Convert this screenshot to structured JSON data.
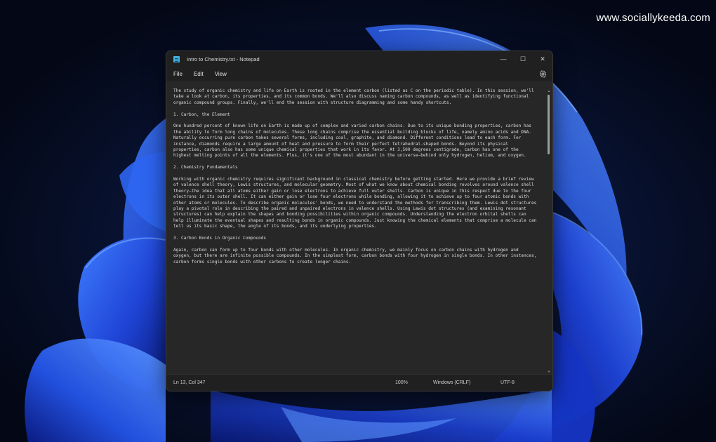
{
  "watermark": "www.sociallykeeda.com",
  "window": {
    "title": "Intro to Chemistry.txt - Notepad",
    "controls": {
      "minimize": "—",
      "maximize": "☐",
      "close": "✕"
    }
  },
  "menu": {
    "file": "File",
    "edit": "Edit",
    "view": "View"
  },
  "document": {
    "paragraphs": [
      "The study of organic chemistry and life on Earth is rooted in the element carbon (listed as C on the periodic table). In this session, we'll take a look at carbon, its properties, and its common bonds. We'll also discuss naming carbon compounds, as well as identifying functional organic compound groups. Finally, we'll end the session with structure diagramming and some handy shortcuts.",
      "1. Carbon, the Element",
      "One hundred percent of known life on Earth is made up of complex and varied carbon chains. Due to its unique bonding properties, carbon has the ability to form long chains of molecules. These long chains comprise the essential building blocks of life, namely amino acids and DNA. Naturally occurring pure carbon takes several forms, including coal, graphite, and diamond. Different conditions lead to each form. For instance, diamonds require a large amount of heat and pressure to form their perfect tetrahedral-shaped bonds. Beyond its physical properties, carbon also has some unique chemical properties that work in its favor. At 3,500 degrees centigrade, carbon has one of the highest melting points of all the elements. Plus, it's one of the most abundant in the universe—behind only hydrogen, helium, and oxygen.",
      "2. Chemistry Fundamentals",
      "Working with organic chemistry requires significant background in classical chemistry before getting started. Here we provide a brief review of valence shell theory, Lewis structures, and molecular geometry. Most of what we know about chemical bonding revolves around valence shell theory—the idea that all atoms either gain or lose electrons to achieve full outer shells. Carbon is unique in this respect due to the four electrons in its outer shell. It can either gain or lose four electrons while bonding, allowing it to achieve up to four atomic bonds with other atoms or molecules. To describe organic molecules' bonds, we need to understand the methods for transcribing them. Lewis dot structures play a pivotal role in describing the paired and unpaired electrons in valence shells. Using Lewis dot structures (and examining resonant structures) can help explain the shapes and bonding possibilities within organic compounds. Understanding the electron orbital shells can help illuminate the eventual shapes and resulting bonds in organic compounds. Just knowing the chemical elements that comprise a molecule can tell us its basic shape, the angle of its bonds, and its underlying properties.",
      "3. Carbon Bonds in Organic Compounds",
      "Again, carbon can form up to four bonds with other molecules. In organic chemistry, we mainly focus on carbon chains with hydrogen and oxygen, but there are infinite possible compounds. In the simplest form, carbon bonds with four hydrogen in single bonds. In other instances, carbon forms single bonds with other carbons to create longer chains."
    ]
  },
  "status": {
    "position": "Ln 13, Col 347",
    "zoom": "100%",
    "line_ending": "Windows (CRLF)",
    "encoding": "UTF-8"
  },
  "colors": {
    "window_bg": "#262626",
    "titlebar_bg": "#202020",
    "text": "#dcdcdc",
    "notepad_icon": "#47b0dd",
    "wallpaper_blue": "#1f4fe0"
  },
  "icons": {
    "app": "notepad-icon",
    "settings": "gear-icon"
  }
}
